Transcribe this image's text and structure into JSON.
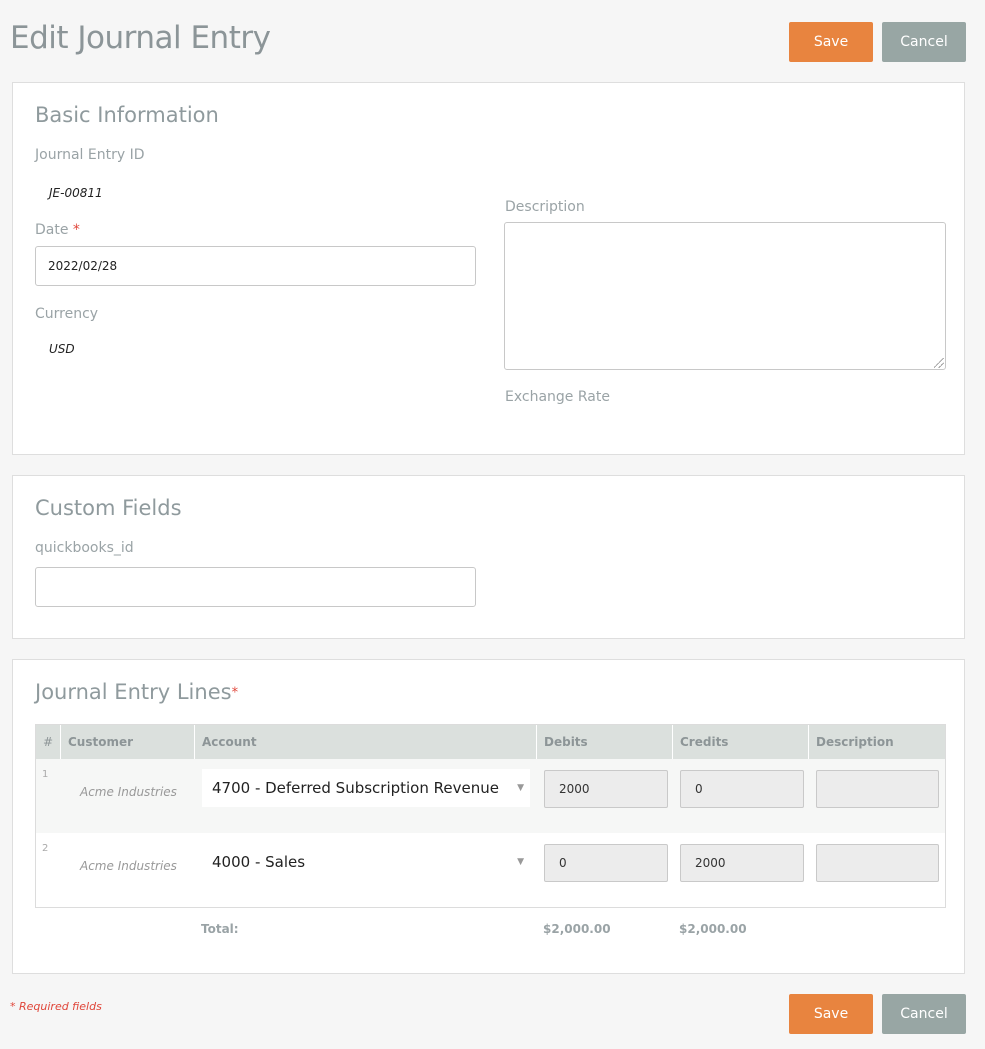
{
  "header": {
    "title": "Edit Journal Entry",
    "save_label": "Save",
    "cancel_label": "Cancel"
  },
  "basic_info": {
    "title": "Basic Information",
    "journal_entry_id_label": "Journal Entry ID",
    "journal_entry_id_value": "JE-00811",
    "date_label": "Date",
    "required_marker": "*",
    "date_value": "2022/02/28",
    "currency_label": "Currency",
    "currency_value": "USD",
    "description_label": "Description",
    "description_value": "",
    "exchange_rate_label": "Exchange Rate"
  },
  "custom_fields": {
    "title": "Custom Fields",
    "quickbooks_id_label": "quickbooks_id",
    "quickbooks_id_value": ""
  },
  "lines": {
    "title": "Journal Entry Lines",
    "required_marker": "*",
    "columns": [
      "#",
      "Customer",
      "Account",
      "Debits",
      "Credits",
      "Description"
    ],
    "rows": [
      {
        "num": "1",
        "customer": "Acme Industries",
        "account": "4700 - Deferred Subscription Revenue",
        "debits": "2000",
        "credits": "0",
        "description": ""
      },
      {
        "num": "2",
        "customer": "Acme Industries",
        "account": "4000 - Sales",
        "debits": "0",
        "credits": "2000",
        "description": ""
      }
    ],
    "total_label": "Total:",
    "total_debits": "$2,000.00",
    "total_credits": "$2,000.00"
  },
  "footer": {
    "required_note": "* Required fields",
    "save_label": "Save",
    "cancel_label": "Cancel"
  },
  "colors": {
    "save_button": "#e8843f",
    "cancel_button": "#98a6a4",
    "required": "#e0463a"
  },
  "icons": {
    "select_caret": "chevron-down-icon",
    "textarea_resize": "resize-grip-icon"
  }
}
